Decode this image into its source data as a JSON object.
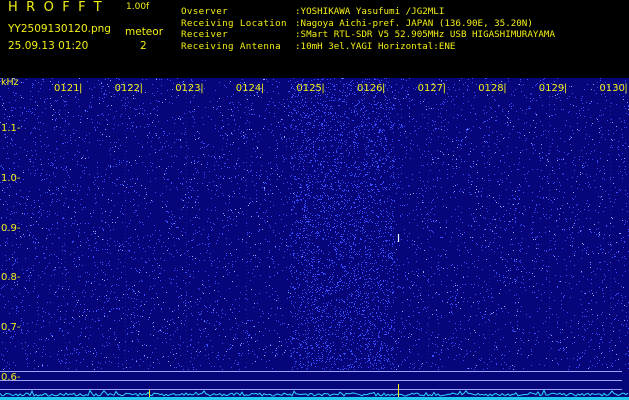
{
  "header": {
    "app_title": "HROFFT",
    "app_version": "1.00f",
    "filename": "YY2509130120.png",
    "datetime": "25.09.13 01:20",
    "meteor_label": "meteor",
    "meteor_count": "2"
  },
  "info": {
    "rows": [
      {
        "label": "Ovserver",
        "value": ":YOSHIKAWA Yasufumi /JG2MLI"
      },
      {
        "label": "Receiving Location",
        "value": ":Nagoya Aichi-pref. JAPAN (136.90E, 35.20N)"
      },
      {
        "label": "Receiver",
        "value": ":SMart RTL-SDR V5 52.905MHz USB HIGASHIMURAYAMA"
      },
      {
        "label": "Receiving Antenna",
        "value": ":10mH 3el.YAGI Horizontal:ENE"
      }
    ]
  },
  "spectrogram": {
    "freq_unit": "kHz",
    "freq_labels": [
      "1.1",
      "1.0",
      "0.9",
      "0.8",
      "0.7",
      "0.6"
    ],
    "time_labels": [
      "0121",
      "0122",
      "0123",
      "0124",
      "0125",
      "0126",
      "0127",
      "0128",
      "0129",
      "0130"
    ],
    "colors": {
      "background": "#06067a",
      "noise": "#3a4cff",
      "label": "#f2ef16",
      "trace": "#2ad8ff"
    }
  }
}
